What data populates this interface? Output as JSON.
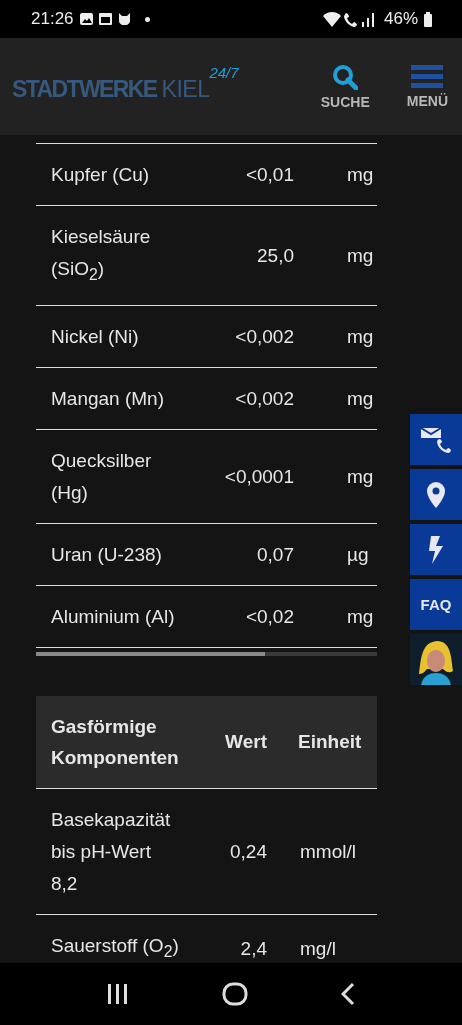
{
  "status_bar": {
    "time": "21:26",
    "battery": "46%"
  },
  "header": {
    "logo": {
      "name": "STADTWERKE",
      "suffix": "KIEL",
      "tag": "24/7"
    },
    "search_label": "SUCHE",
    "menu_label": "MENÜ"
  },
  "table_1": {
    "rows": [
      {
        "name": "Kupfer (Cu)",
        "value": "<0,01",
        "unit": "mg"
      },
      {
        "name": "Kieselsäure (SiO$_{2}$)",
        "value": "25,0",
        "unit": "mg"
      },
      {
        "name": "Nickel (Ni)",
        "value": "<0,002",
        "unit": "mg"
      },
      {
        "name": "Mangan (Mn)",
        "value": "<0,002",
        "unit": "mg"
      },
      {
        "name": "Quecksilber (Hg)",
        "value": "<0,0001",
        "unit": "mg"
      },
      {
        "name": "Uran (U-238)",
        "value": "0,07",
        "unit": "µg"
      },
      {
        "name": "Aluminium (Al)",
        "value": "<0,02",
        "unit": "mg"
      }
    ]
  },
  "table_2": {
    "columns": [
      "Gasförmige Komponenten",
      "Wert",
      "Einheit"
    ],
    "rows": [
      {
        "name": "Basekapazität bis pH-Wert 8,2",
        "value": "0,24",
        "unit": "mmol/l"
      },
      {
        "name": "Sauerstoff (O$_{2}$)",
        "value": "2,4",
        "unit": "mg/l"
      }
    ]
  },
  "side_buttons": [
    {
      "kind": "contact"
    },
    {
      "kind": "location"
    },
    {
      "kind": "outage"
    },
    {
      "kind": "text",
      "label": "FAQ"
    },
    {
      "kind": "avatar"
    }
  ]
}
